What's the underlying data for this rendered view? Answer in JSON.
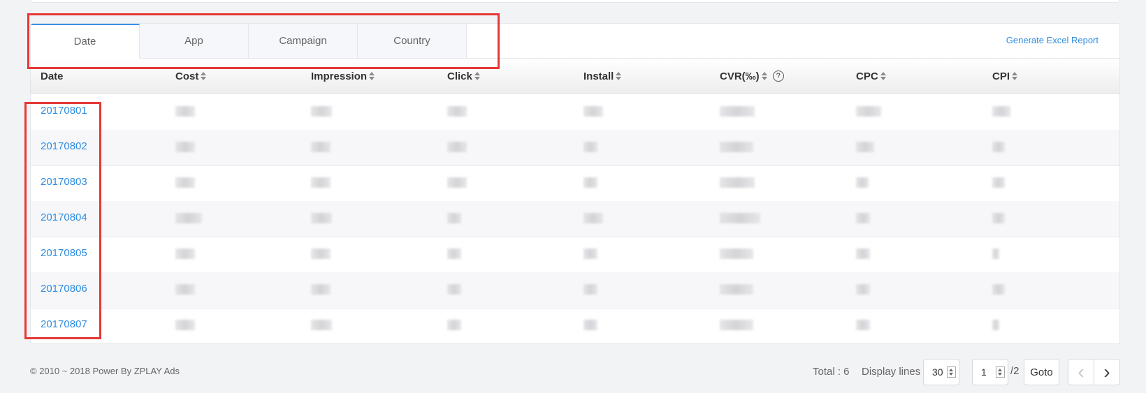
{
  "tabs": [
    {
      "label": "Date",
      "active": true
    },
    {
      "label": "App",
      "active": false
    },
    {
      "label": "Campaign",
      "active": false
    },
    {
      "label": "Country",
      "active": false
    }
  ],
  "excel_link": "Generate Excel Report",
  "columns": [
    "Date",
    "Cost",
    "Impression",
    "Click",
    "Install",
    "CVR(‰)",
    "CPC",
    "CPI"
  ],
  "help_icon_glyph": "?",
  "rows": [
    {
      "date": "20170801"
    },
    {
      "date": "20170802"
    },
    {
      "date": "20170803"
    },
    {
      "date": "20170804"
    },
    {
      "date": "20170805"
    },
    {
      "date": "20170806"
    },
    {
      "date": "20170807"
    }
  ],
  "footer": {
    "copyright": "© 2010 ~ 2018 Power By ZPLAY Ads",
    "total": "Total : 6",
    "display_lines_label": "Display lines",
    "display_lines_value": "30",
    "page_value": "1",
    "page_total": "/2",
    "goto": "Goto",
    "prev_glyph": "‹",
    "next_glyph": "›"
  },
  "colors": {
    "accent": "#2e8de0",
    "highlight": "#e53935"
  }
}
